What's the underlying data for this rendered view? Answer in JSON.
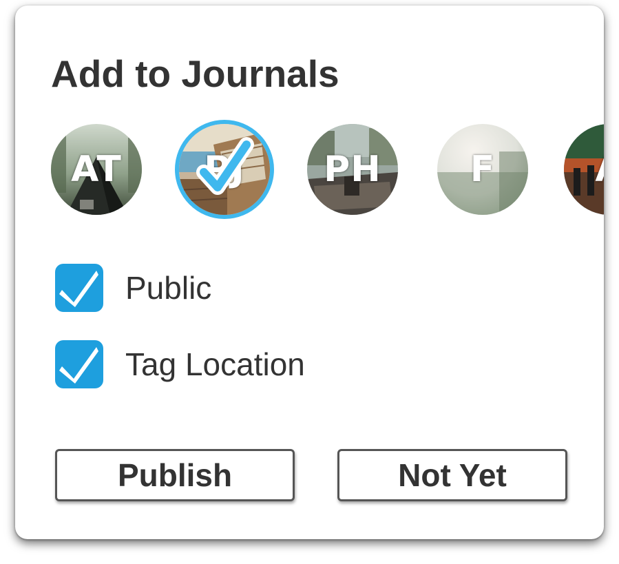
{
  "dialog": {
    "title": "Add to Journals"
  },
  "journals": [
    {
      "initials": "AT",
      "selected": false
    },
    {
      "initials": "PJ",
      "selected": true
    },
    {
      "initials": "PH",
      "selected": false
    },
    {
      "initials": "F",
      "selected": false
    },
    {
      "initials": "A",
      "selected": false
    }
  ],
  "options": {
    "public_label": "Public",
    "public_checked": true,
    "tag_location_label": "Tag Location",
    "tag_location_checked": true
  },
  "buttons": {
    "publish_label": "Publish",
    "not_yet_label": "Not Yet"
  },
  "colors": {
    "accent": "#1e9fde",
    "selection_ring": "#3fb8ee",
    "text": "#333333",
    "button_border": "#555555"
  }
}
